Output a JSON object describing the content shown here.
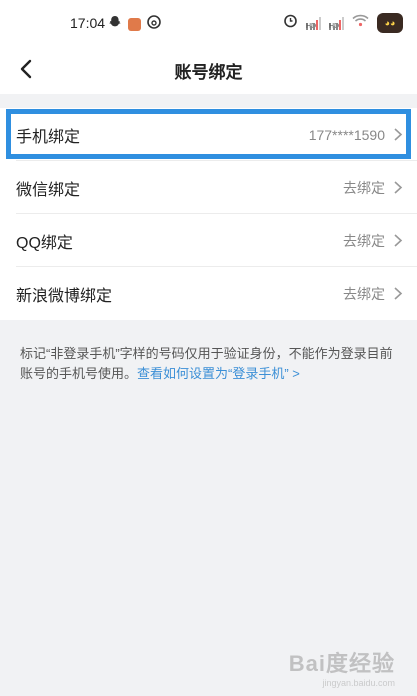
{
  "status_bar": {
    "time": "17:04",
    "left_icons": [
      "snapchat-icon",
      "app-notification-icon",
      "netease-music-icon"
    ],
    "right_icons": [
      "alarm-icon",
      "signal-hd-1-icon",
      "signal-hd-2-icon",
      "wifi-icon",
      "avatar-icon"
    ],
    "hd_label": "HD"
  },
  "nav": {
    "back_icon": "chevron-left-icon",
    "title": "账号绑定"
  },
  "bindings": [
    {
      "label": "手机绑定",
      "value": "177****1590"
    },
    {
      "label": "微信绑定",
      "value": "去绑定"
    },
    {
      "label": "QQ绑定",
      "value": "去绑定"
    },
    {
      "label": "新浪微博绑定",
      "value": "去绑定"
    }
  ],
  "note": {
    "text": "标记“非登录手机”字样的号码仅用于验证身份，不能作为登录目前账号的手机号使用。",
    "link": "查看如何设置为“登录手机” >"
  },
  "watermark": {
    "main": "Bai度经验",
    "sub": "jingyan.baidu.com"
  },
  "colors": {
    "highlight": "#2f8fe0",
    "link": "#3b8fd6",
    "background": "#f1f2f4"
  }
}
